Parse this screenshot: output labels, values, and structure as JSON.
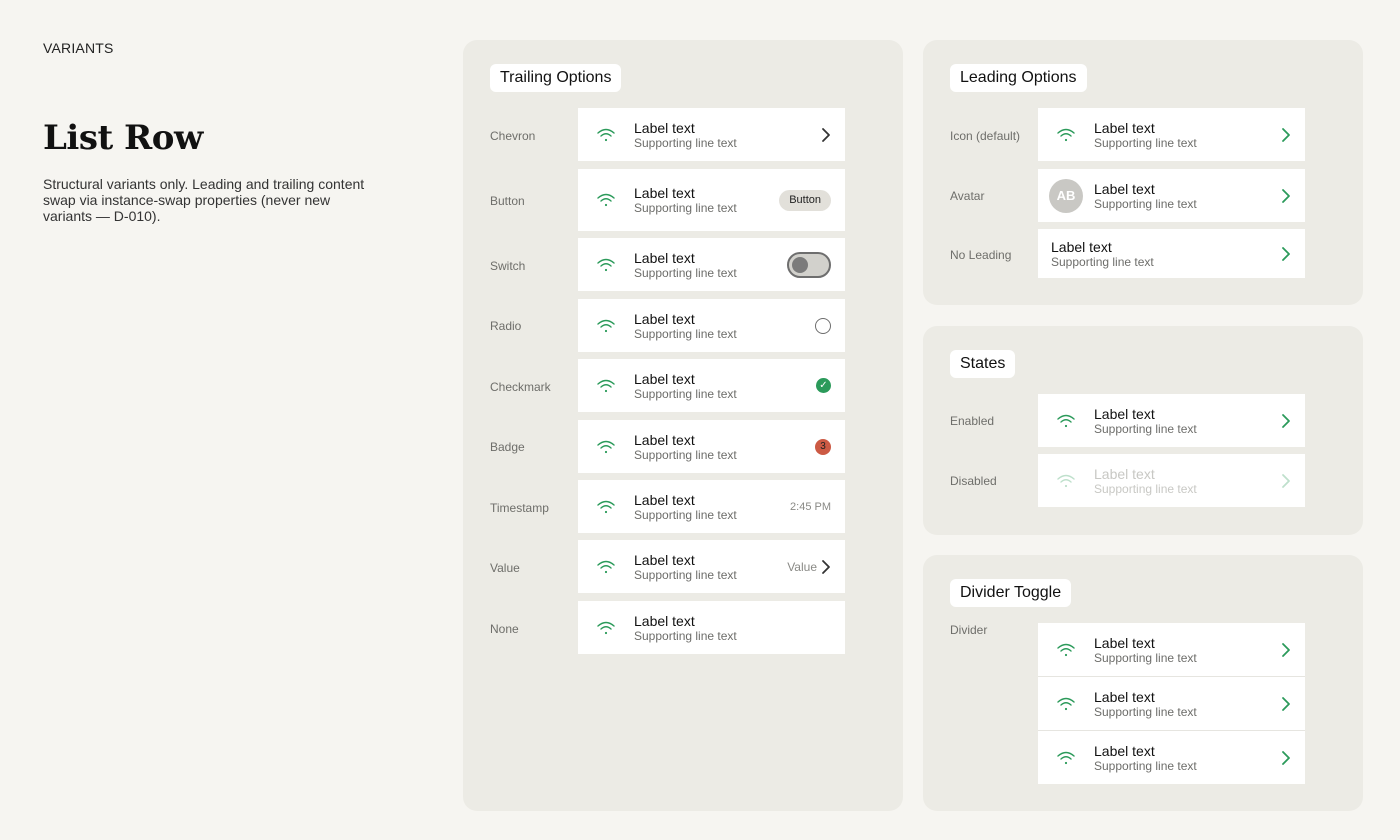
{
  "intro": {
    "eyebrow": "VARIANTS",
    "title": "List Row",
    "description": "Structural variants only. Leading and trailing content swap via instance-swap properties (never new variants — D-010)."
  },
  "colors": {
    "accent": "#2b9a5a",
    "badge": "#cc5a44",
    "panel": "#ecebe5",
    "page": "#f6f5f1"
  },
  "trailing": {
    "title": "Trailing Options",
    "rows": [
      {
        "label": "Chevron",
        "item_label": "Label text",
        "supporting": "Supporting line text",
        "trailing": "chevron"
      },
      {
        "label": "Button",
        "item_label": "Label text",
        "supporting": "Supporting line text",
        "trailing": "button",
        "button_label": "Button"
      },
      {
        "label": "Switch",
        "item_label": "Label text",
        "supporting": "Supporting line text",
        "trailing": "switch"
      },
      {
        "label": "Radio",
        "item_label": "Label text",
        "supporting": "Supporting line text",
        "trailing": "radio"
      },
      {
        "label": "Checkmark",
        "item_label": "Label text",
        "supporting": "Supporting line text",
        "trailing": "checkmark",
        "check_glyph": "✓"
      },
      {
        "label": "Badge",
        "item_label": "Label text",
        "supporting": "Supporting line text",
        "trailing": "badge",
        "badge_count": "3"
      },
      {
        "label": "Timestamp",
        "item_label": "Label text",
        "supporting": "Supporting line text",
        "trailing": "timestamp",
        "timestamp": "2:45 PM"
      },
      {
        "label": "Value",
        "item_label": "Label text",
        "supporting": "Supporting line text",
        "trailing": "value",
        "value": "Value"
      },
      {
        "label": "None",
        "item_label": "Label text",
        "supporting": "Supporting line text",
        "trailing": "none"
      }
    ]
  },
  "leading": {
    "title": "Leading Options",
    "rows": [
      {
        "label": "Icon (default)",
        "item_label": "Label text",
        "supporting": "Supporting line text",
        "leading": "wifi-icon"
      },
      {
        "label": "Avatar",
        "item_label": "Label text",
        "supporting": "Supporting line text",
        "leading": "avatar",
        "avatar_initials": "AB"
      },
      {
        "label": "No Leading",
        "item_label": "Label text",
        "supporting": "Supporting line text",
        "leading": "none"
      }
    ]
  },
  "states": {
    "title": "States",
    "rows": [
      {
        "label": "Enabled",
        "item_label": "Label text",
        "supporting": "Supporting line text"
      },
      {
        "label": "Disabled",
        "item_label": "Label text",
        "supporting": "Supporting line text"
      }
    ]
  },
  "divider": {
    "title": "Divider Toggle",
    "label": "Divider",
    "items": [
      {
        "item_label": "Label text",
        "supporting": "Supporting line text"
      },
      {
        "item_label": "Label text",
        "supporting": "Supporting line text"
      },
      {
        "item_label": "Label text",
        "supporting": "Supporting line text"
      }
    ]
  }
}
